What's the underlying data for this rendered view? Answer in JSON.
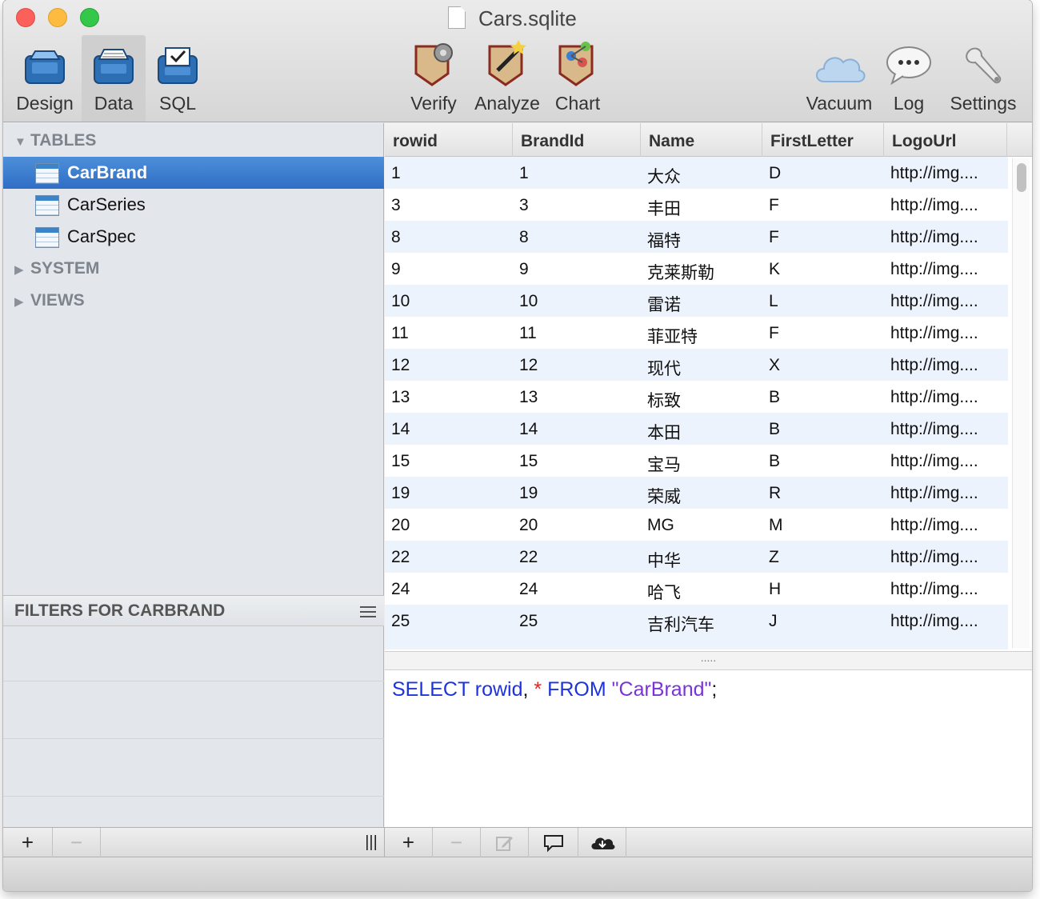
{
  "window": {
    "title": "Cars.sqlite"
  },
  "toolbar": {
    "left": [
      {
        "label": "Design",
        "icon": "design-icon"
      },
      {
        "label": "Data",
        "icon": "data-icon",
        "selected": true
      },
      {
        "label": "SQL",
        "icon": "sql-icon"
      }
    ],
    "center": [
      {
        "label": "Verify",
        "icon": "verify-tag-icon"
      },
      {
        "label": "Analyze",
        "icon": "analyze-tag-icon"
      },
      {
        "label": "Chart",
        "icon": "chart-tag-icon"
      }
    ],
    "right": [
      {
        "label": "Vacuum",
        "icon": "cloud-icon"
      },
      {
        "label": "Log",
        "icon": "speech-bubble-icon"
      },
      {
        "label": "Settings",
        "icon": "wrench-icon"
      }
    ]
  },
  "sidebar": {
    "tables_header": "TABLES",
    "tables": [
      "CarBrand",
      "CarSeries",
      "CarSpec"
    ],
    "selected_table": "CarBrand",
    "system_header": "SYSTEM",
    "views_header": "VIEWS"
  },
  "filters": {
    "title": "FILTERS FOR CARBRAND"
  },
  "grid": {
    "columns": [
      "rowid",
      "BrandId",
      "Name",
      "FirstLetter",
      "LogoUrl"
    ],
    "rows": [
      [
        "1",
        "1",
        "大众",
        "D",
        "http://img...."
      ],
      [
        "3",
        "3",
        "丰田",
        "F",
        "http://img...."
      ],
      [
        "8",
        "8",
        "福特",
        "F",
        "http://img...."
      ],
      [
        "9",
        "9",
        "克莱斯勒",
        "K",
        "http://img...."
      ],
      [
        "10",
        "10",
        "雷诺",
        "L",
        "http://img...."
      ],
      [
        "11",
        "11",
        "菲亚特",
        "F",
        "http://img...."
      ],
      [
        "12",
        "12",
        "现代",
        "X",
        "http://img...."
      ],
      [
        "13",
        "13",
        "标致",
        "B",
        "http://img...."
      ],
      [
        "14",
        "14",
        "本田",
        "B",
        "http://img...."
      ],
      [
        "15",
        "15",
        "宝马",
        "B",
        "http://img...."
      ],
      [
        "19",
        "19",
        "荣威",
        "R",
        "http://img...."
      ],
      [
        "20",
        "20",
        "MG",
        "M",
        "http://img...."
      ],
      [
        "22",
        "22",
        "中华",
        "Z",
        "http://img...."
      ],
      [
        "24",
        "24",
        "哈飞",
        "H",
        "http://img...."
      ],
      [
        "25",
        "25",
        "吉利汽车",
        "J",
        "http://img...."
      ]
    ]
  },
  "splitter": {
    "handle": "....."
  },
  "sql": {
    "tokens": [
      {
        "text": "SELECT rowid",
        "kind": "kw"
      },
      {
        "text": ", ",
        "kind": "plain"
      },
      {
        "text": "*",
        "kind": "star"
      },
      {
        "text": " FROM ",
        "kind": "kw"
      },
      {
        "text": "\"CarBrand\"",
        "kind": "str"
      },
      {
        "text": ";",
        "kind": "plain"
      }
    ]
  },
  "bottom_left": {
    "add": "+",
    "remove": "−",
    "columns": "|||"
  },
  "bottom_right": {
    "add": "+",
    "remove": "−"
  },
  "colors": {
    "selection": "#2f6ec5",
    "row_alt": "#edf3fd",
    "sql_keyword": "#1c33dd",
    "sql_string": "#7a33d6",
    "sql_operator": "#e02424"
  }
}
